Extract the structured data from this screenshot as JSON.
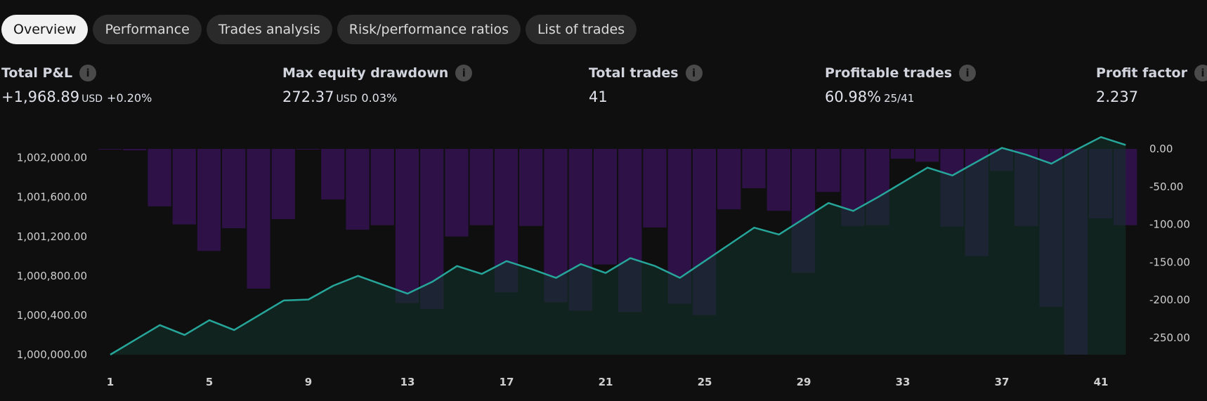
{
  "tabs": [
    {
      "label": "Overview",
      "active": true
    },
    {
      "label": "Performance",
      "active": false
    },
    {
      "label": "Trades analysis",
      "active": false
    },
    {
      "label": "Risk/performance ratios",
      "active": false
    },
    {
      "label": "List of trades",
      "active": false
    }
  ],
  "metrics": {
    "total_pnl": {
      "label": "Total P&L",
      "value": "+1,968.89",
      "unit": "USD",
      "pct": "+0.20%"
    },
    "max_drawdown": {
      "label": "Max equity drawdown",
      "value": "272.37",
      "unit": "USD",
      "pct": "0.03%"
    },
    "total_trades": {
      "label": "Total trades",
      "value": "41"
    },
    "profitable_trades": {
      "label": "Profitable trades",
      "value": "60.98%",
      "sub": "25/41"
    },
    "profit_factor": {
      "label": "Profit factor",
      "value": "2.237"
    }
  },
  "info_icon_glyph": "i",
  "colors": {
    "background": "#0f0f0f",
    "equity_line": "#26a69a",
    "equity_fill": "#133029",
    "drawdown_bar": "#2e1247",
    "active_tab": "#f2f2f2"
  },
  "chart_data": {
    "type": "line",
    "x": [
      1,
      2,
      3,
      4,
      5,
      6,
      7,
      8,
      9,
      10,
      11,
      12,
      13,
      14,
      15,
      16,
      17,
      18,
      19,
      20,
      21,
      22,
      23,
      24,
      25,
      26,
      27,
      28,
      29,
      30,
      31,
      32,
      33,
      34,
      35,
      36,
      37,
      38,
      39,
      40,
      41,
      42
    ],
    "x_ticks": [
      1,
      5,
      9,
      13,
      17,
      21,
      25,
      29,
      33,
      37,
      41
    ],
    "left_axis": {
      "ticks": [
        1000000,
        1000400,
        1000800,
        1001200,
        1001600,
        1002000
      ],
      "tick_labels": [
        "1,000,000.00",
        "1,000,400.00",
        "1,000,800.00",
        "1,001,200.00",
        "1,001,600.00",
        "1,002,000.00"
      ],
      "range": [
        1000000,
        1002090
      ]
    },
    "right_axis": {
      "ticks": [
        0,
        -50,
        -100,
        -150,
        -200,
        -250
      ],
      "tick_labels": [
        "0.00",
        "-50.00",
        "-100.00",
        "-150.00",
        "-200.00",
        "-250.00"
      ],
      "range": [
        -272.37,
        0
      ]
    },
    "series": [
      {
        "type": "area",
        "axis": "left",
        "color": "#26a69a",
        "values": [
          1000000,
          1000150,
          1000300,
          1000200,
          1000350,
          1000250,
          1000400,
          1000550,
          1000560,
          1000700,
          1000800,
          1000710,
          1000620,
          1000740,
          1000900,
          1000820,
          1000950,
          1000870,
          1000780,
          1000920,
          1000830,
          1000980,
          1000900,
          1000780,
          1000950,
          1001120,
          1001290,
          1001220,
          1001380,
          1001540,
          1001460,
          1001600,
          1001750,
          1001900,
          1001820,
          1001960,
          1002100,
          1002030,
          1001940,
          1002080,
          1002210,
          1002130
        ]
      },
      {
        "type": "bar",
        "axis": "right",
        "color": "#2e1247",
        "values": [
          -1,
          -2,
          -76,
          -100,
          -135,
          -105,
          -185,
          -93,
          -1,
          -67,
          -107,
          -101,
          -204,
          -212,
          -116,
          -101,
          -190,
          -102,
          -203,
          -214,
          -153,
          -216,
          -104,
          -205,
          -220,
          -80,
          -52,
          -82,
          -164,
          -57,
          -102,
          -101,
          -13,
          -17,
          -103,
          -142,
          -29,
          -102,
          -209,
          -272.37,
          -92,
          -101
        ]
      }
    ]
  }
}
